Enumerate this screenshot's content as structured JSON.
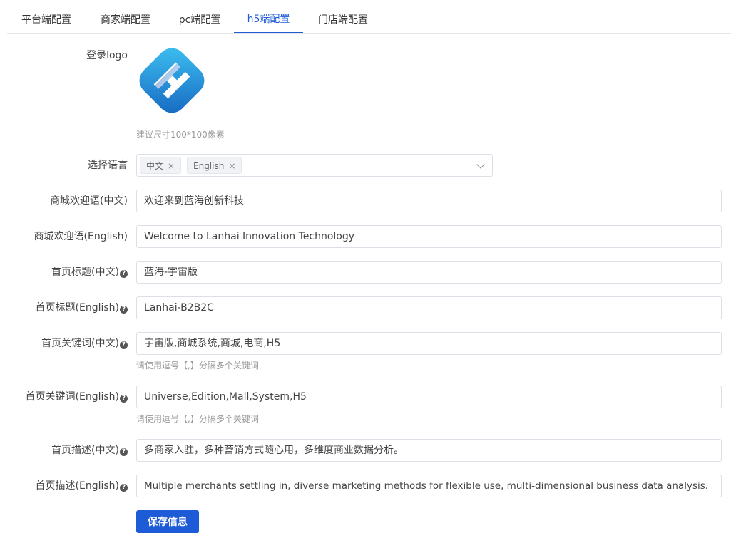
{
  "tabs": [
    {
      "label": "平台端配置",
      "active": false
    },
    {
      "label": "商家端配置",
      "active": false
    },
    {
      "label": "pc端配置",
      "active": false
    },
    {
      "label": "h5端配置",
      "active": true
    },
    {
      "label": "门店端配置",
      "active": false
    }
  ],
  "form": {
    "login_logo": {
      "label": "登录logo",
      "hint": "建议尺寸100*100像素",
      "icon": "blue-h-logo"
    },
    "language": {
      "label": "选择语言",
      "tags": [
        "中文",
        "English"
      ],
      "close_glyph": "×"
    },
    "welcome_zh": {
      "label": "商城欢迎语(中文)",
      "value": "欢迎来到蓝海创新科技"
    },
    "welcome_en": {
      "label": "商城欢迎语(English)",
      "value": "Welcome to Lanhai Innovation Technology"
    },
    "title_zh": {
      "label": "首页标题(中文)",
      "value": "蓝海-宇宙版"
    },
    "title_en": {
      "label": "首页标题(English)",
      "value": "Lanhai-B2B2C"
    },
    "keywords_zh": {
      "label": "首页关键词(中文)",
      "value": "宇宙版,商城系统,商城,电商,H5",
      "hint": "请使用逗号【,】分隔多个关键词"
    },
    "keywords_en": {
      "label": "首页关键词(English)",
      "value": "Universe,Edition,Mall,System,H5",
      "hint": "请使用逗号【,】分隔多个关键词"
    },
    "desc_zh": {
      "label": "首页描述(中文)",
      "value": "多商家入驻，多种营销方式随心用，多维度商业数据分析。"
    },
    "desc_en": {
      "label": "首页描述(English)",
      "value": "Multiple merchants settling in, diverse marketing methods for flexible use, multi-dimensional business data analysis."
    },
    "help_glyph": "?"
  },
  "save_button": {
    "label": "保存信息"
  },
  "colors": {
    "accent": "#1e5bd6",
    "border": "#dcdfe6",
    "hint": "#999999"
  }
}
